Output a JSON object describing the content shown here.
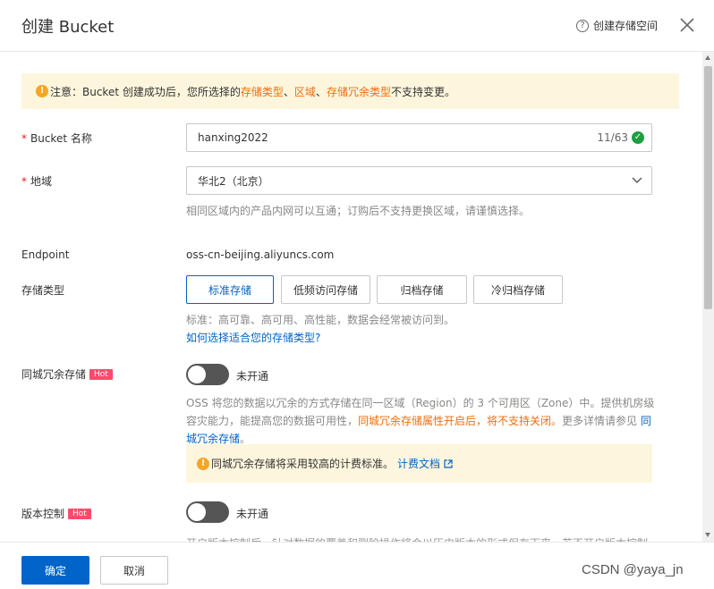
{
  "header": {
    "title": "创建 Bucket",
    "help_label": "创建存储空间"
  },
  "warning": {
    "prefix": "注意：Bucket 创建成功后，您所选择的 ",
    "h1": "存储类型",
    "sep1": "、",
    "h2": "区域",
    "sep2": "、",
    "h3": "存储冗余类型",
    "suffix": " 不支持变更。"
  },
  "bucket_name": {
    "label": "Bucket 名称",
    "value": "hanxing2022",
    "count": "11/63"
  },
  "region": {
    "label": "地域",
    "value": "华北2（北京）",
    "desc": "相同区域内的产品内网可以互通；订购后不支持更换区域，请谨慎选择。"
  },
  "endpoint": {
    "label": "Endpoint",
    "value": "oss-cn-beijing.aliyuncs.com"
  },
  "storage_class": {
    "label": "存储类型",
    "options": [
      "标准存储",
      "低频访问存储",
      "归档存储",
      "冷归档存储"
    ],
    "desc": "标准：高可靠、高可用、高性能，数据会经常被访问到。",
    "link": "如何选择适合您的存储类型?"
  },
  "redundancy": {
    "label": "同城冗余存储",
    "hot": "Hot",
    "status": "未开通",
    "desc_a": "OSS 将您的数据以冗余的方式存储在同一区域（Region）的 3 个可用区（Zone）中。提供机房级容灾能力，能提高您的数据可用性，",
    "desc_hl": "同城冗余存储属性开启后，将不支持关闭。",
    "desc_b": "更多详情请参见 ",
    "desc_link": "同城冗余存储",
    "desc_end": "。",
    "note": "同城冗余存储将采用较高的计费标准。",
    "note_link": "计费文档"
  },
  "versioning": {
    "label": "版本控制",
    "hot": "Hot",
    "status": "未开通",
    "desc": "开启版本控制后，针对数据的覆盖和删除操作将会以历史版本的形式保存下来，若不开启版本控制"
  },
  "footer": {
    "confirm": "确定",
    "cancel": "取消",
    "watermark": "CSDN @yaya_jn"
  }
}
